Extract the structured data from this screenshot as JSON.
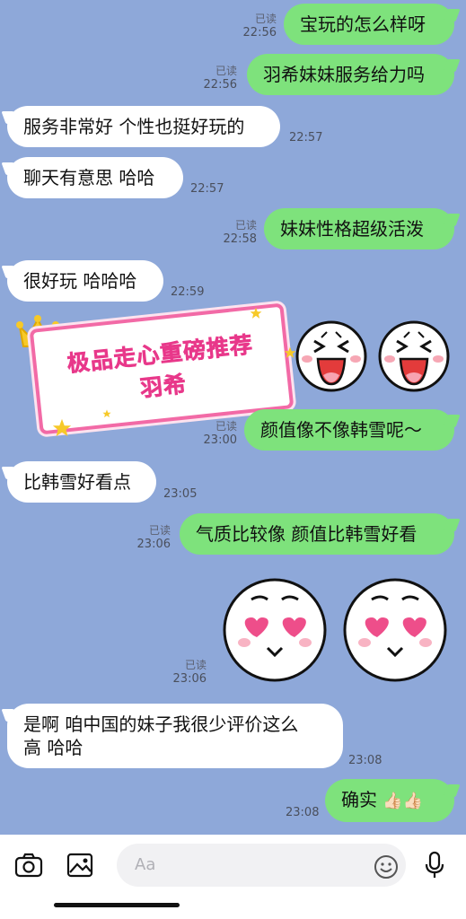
{
  "messages": [
    {
      "side": "me",
      "text": "宝玩的怎么样呀",
      "read": "已读",
      "time": "22:56"
    },
    {
      "side": "me",
      "text": "羽希妹妹服务给力吗",
      "read": "已读",
      "time": "22:56"
    },
    {
      "side": "them",
      "text": "服务非常好 个性也挺好玩的",
      "time": "22:57"
    },
    {
      "side": "them",
      "text": "聊天有意思 哈哈",
      "time": "22:57"
    },
    {
      "side": "me",
      "text": "妹妹性格超级活泼",
      "read": "已读",
      "time": "22:58"
    },
    {
      "side": "them",
      "text": "很好玩 哈哈哈",
      "time": "22:59"
    },
    {
      "side": "me",
      "text": "颜值像不像韩雪呢～",
      "read": "已读",
      "time": "23:00"
    },
    {
      "side": "them",
      "text": "比韩雪好看点",
      "time": "23:05"
    },
    {
      "side": "me",
      "text": "气质比较像 颜值比韩雪好看",
      "read": "已读",
      "time": "23:06"
    },
    {
      "side": "me",
      "text": "sticker",
      "read": "已读",
      "time": "23:06"
    },
    {
      "side": "them",
      "text_line1": "是啊 咱中国的妹子我很少评价这么",
      "text_line2": "高 哈哈",
      "time": "23:08"
    },
    {
      "side": "me",
      "text": "确实",
      "emoji": "👍🏻👍🏻",
      "time": "23:08"
    }
  ],
  "banner": {
    "line1": "极品走心重磅推荐",
    "line2": "羽希"
  },
  "input": {
    "placeholder": "Aa"
  },
  "icons": {
    "camera": "camera-icon",
    "gallery": "image-icon",
    "emoji": "smiley-icon",
    "mic": "microphone-icon"
  },
  "colors": {
    "background": "#8ea8d9",
    "my_bubble": "#7ee27c",
    "their_bubble": "#ffffff",
    "banner_accent": "#e8388a"
  }
}
